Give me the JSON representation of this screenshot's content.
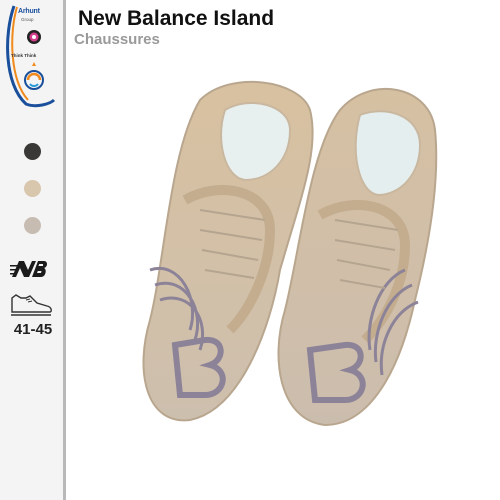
{
  "product": {
    "title": "New Balance Island",
    "category": "Chaussures"
  },
  "sidebar": {
    "brand": {
      "name": "Arhunt",
      "sub": "Group",
      "think": "Think Think"
    },
    "swatches": [
      {
        "color": "#3a3836",
        "icon": "color-swatch-dark"
      },
      {
        "color": "#d8c6ad",
        "icon": "color-swatch-beige"
      },
      {
        "color": "#c7bcb1",
        "icon": "color-swatch-grey"
      }
    ],
    "brand_icon": "new-balance-logo-icon",
    "shoe_icon": "shoe-outline-icon",
    "size": "41-45"
  },
  "colors": {
    "accent_blue": "#1a4f9c",
    "accent_orange": "#f08a1c",
    "sidebar_bg": "#f4f4f4"
  }
}
